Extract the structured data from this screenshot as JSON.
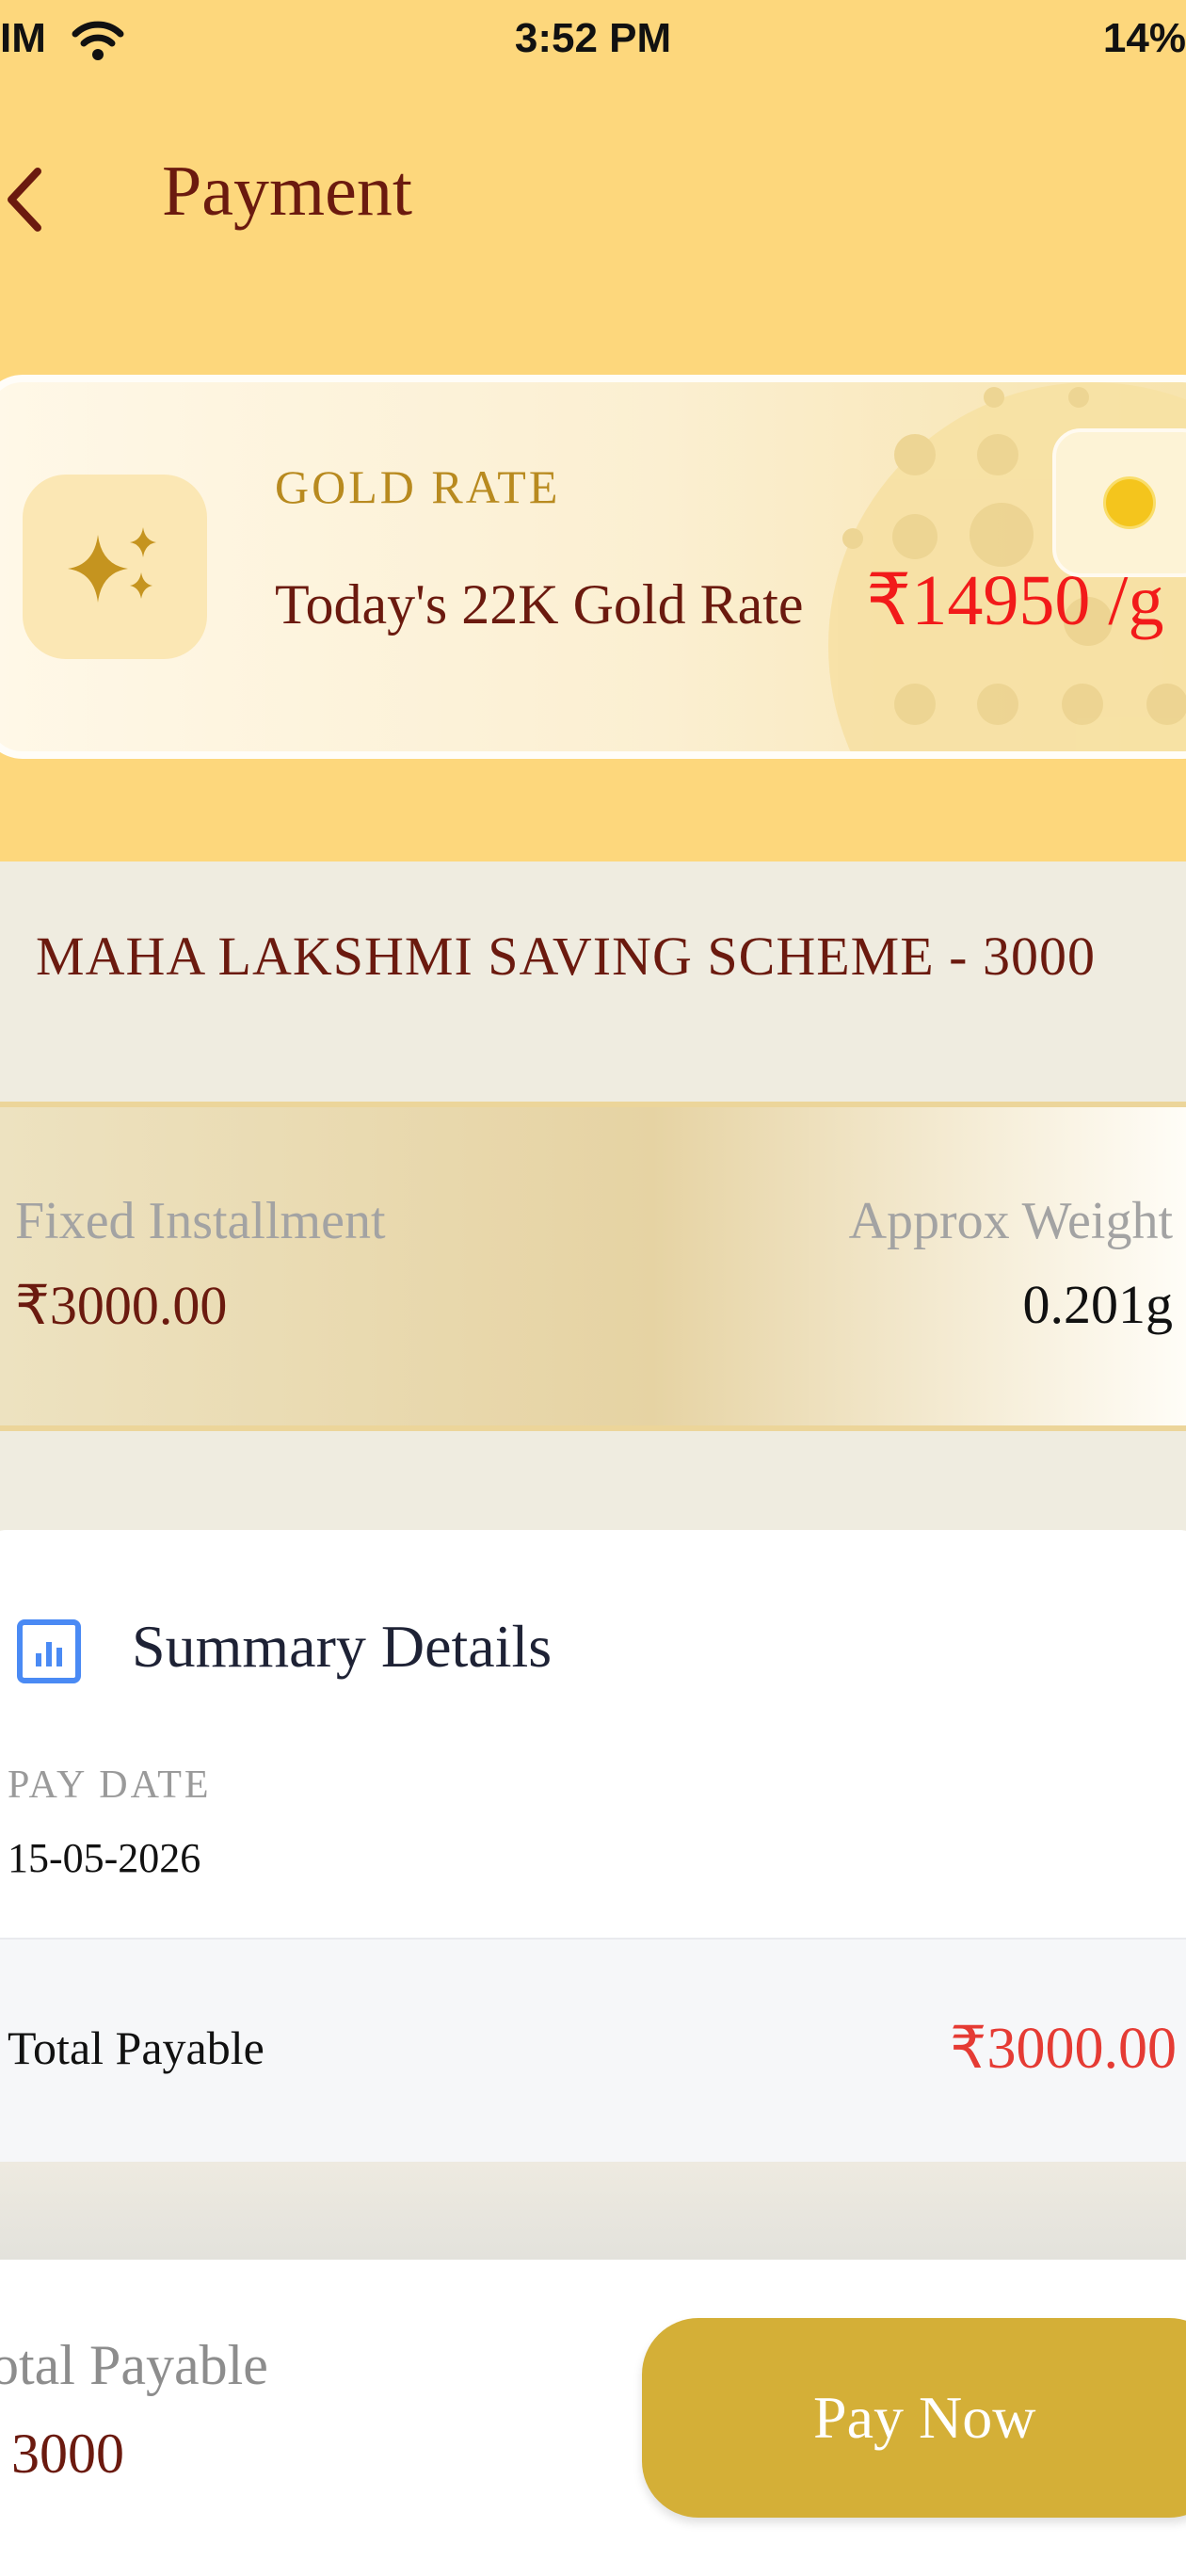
{
  "status_bar": {
    "carrier": "IM",
    "time": "3:52 PM",
    "battery": "14%"
  },
  "header": {
    "title": "Payment"
  },
  "gold_rate": {
    "label": "GOLD RATE",
    "description": "Today's 22K Gold Rate",
    "value": "₹14950 /g"
  },
  "scheme": {
    "title": "MAHA LAKSHMI SAVING SCHEME - 3000",
    "installment_label": "Fixed Installment",
    "installment_value": "₹3000.00",
    "weight_label": "Approx Weight",
    "weight_value": "0.201g"
  },
  "summary": {
    "title": "Summary Details",
    "pay_date_label": "PAY DATE",
    "pay_date_value": "15-05-2026",
    "total_label": "Total Payable",
    "total_value": "₹3000.00"
  },
  "footer": {
    "total_label": "otal Payable",
    "total_value": "3000",
    "pay_button": "Pay Now"
  },
  "colors": {
    "header_bg": "#fdd77c",
    "brand_maroon": "#6b1a0f",
    "rate_red": "#f21a1a",
    "pay_button": "#d4af37"
  }
}
